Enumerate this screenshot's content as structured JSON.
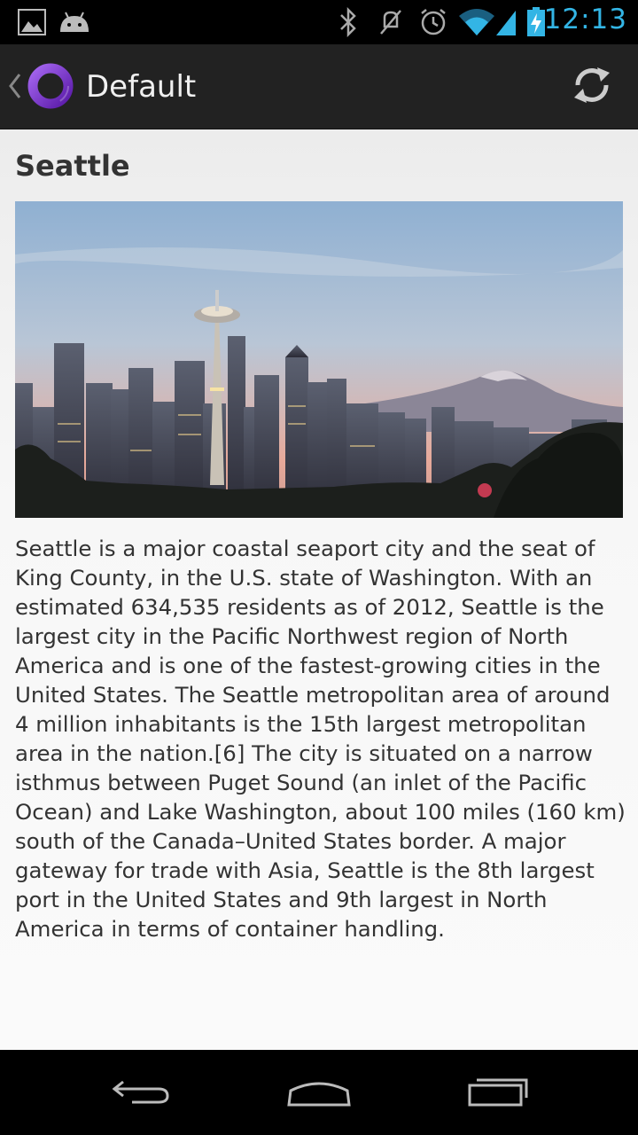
{
  "status_bar": {
    "time": "12:13",
    "icons": [
      "gallery-notification-icon",
      "android-notification-icon",
      "bluetooth-icon",
      "vibrate-off-icon",
      "alarm-icon",
      "wifi-icon",
      "signal-icon",
      "battery-charging-icon"
    ]
  },
  "action_bar": {
    "title": "Default",
    "up_icon": "chevron-left-icon",
    "app_icon": "ring-logo-icon",
    "refresh_icon": "refresh-icon"
  },
  "article": {
    "title": "Seattle",
    "description": "Seattle is a major coastal seaport city and the seat of King County, in the U.S. state of Washington. With an estimated 634,535 residents as of 2012, Seattle is the largest city in the Pacific Northwest region of North America and is one of the fastest-growing cities in the United States. The Seattle metropolitan area of around 4 million inhabitants is the 15th largest metropolitan area in the nation.[6] The city is situated on a narrow isthmus between Puget Sound (an inlet of the Pacific Ocean) and Lake Washington, about 100 miles (160 km) south of the Canada–United States border. A major gateway for trade with Asia, Seattle is the 8th largest port in the United States and 9th largest in North America in terms of container handling."
  },
  "nav_bar": {
    "back_icon": "back-icon",
    "home_icon": "home-icon",
    "recents_icon": "recent-apps-icon"
  },
  "colors": {
    "status_time": "#33b5e5",
    "action_bar_bg": "#222222",
    "logo_purple": "#7b3fc4",
    "text": "#333333"
  }
}
